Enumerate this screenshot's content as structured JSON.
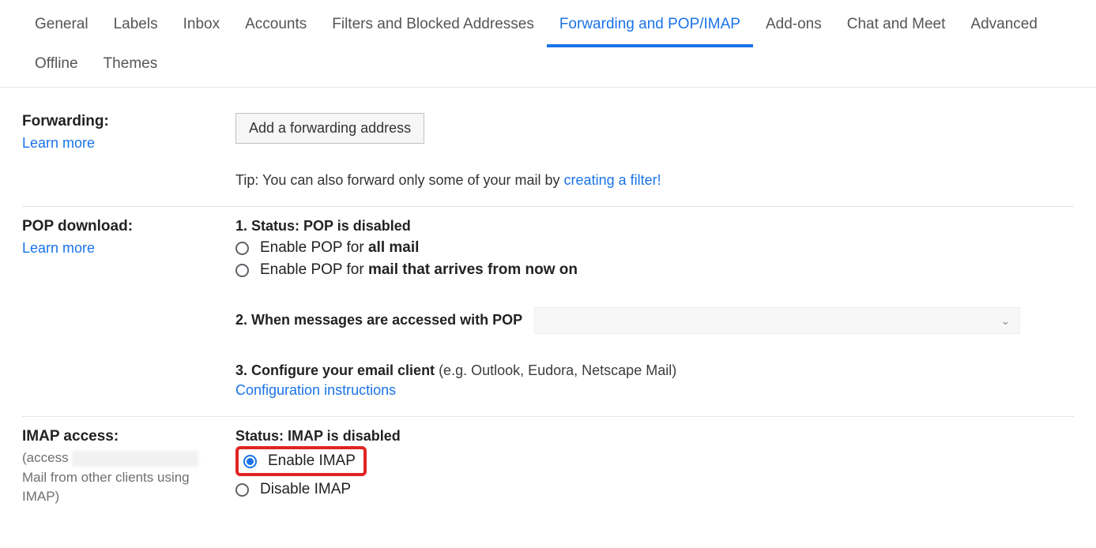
{
  "tabs": {
    "row": [
      "General",
      "Labels",
      "Inbox",
      "Accounts",
      "Filters and Blocked Addresses",
      "Forwarding and POP/IMAP",
      "Add-ons",
      "Chat and Meet",
      "Advanced",
      "Offline",
      "Themes"
    ],
    "active": "Forwarding and POP/IMAP"
  },
  "forwarding": {
    "title": "Forwarding:",
    "learn": "Learn more",
    "button": "Add a forwarding address",
    "tip_prefix": "Tip: You can also forward only some of your mail by ",
    "tip_link": "creating a filter!"
  },
  "pop": {
    "title": "POP download:",
    "learn": "Learn more",
    "status_prefix": "1. Status: ",
    "status_value": "POP is disabled",
    "opt1_prefix": "Enable POP for ",
    "opt1_bold": "all mail",
    "opt2_prefix": "Enable POP for ",
    "opt2_bold": "mail that arrives from now on",
    "line2": "2. When messages are accessed with POP",
    "line3_bold": "3. Configure your email client",
    "line3_rest": " (e.g. Outlook, Eudora, Netscape Mail)",
    "config_link": "Configuration instructions"
  },
  "imap": {
    "title": "IMAP access:",
    "sub_prefix": "(access ",
    "sub_line2": "Mail from other clients using IMAP)",
    "status_label": "Status: IMAP is disabled",
    "opt_enable": "Enable IMAP",
    "opt_disable": "Disable IMAP"
  }
}
